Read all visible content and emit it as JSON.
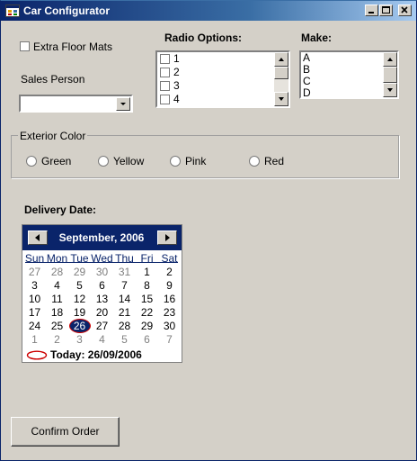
{
  "window": {
    "title": "Car Configurator",
    "controls": [
      "minimize",
      "maximize",
      "close"
    ]
  },
  "options": {
    "extra_floor_mats_label": "Extra Floor Mats",
    "extra_floor_mats_checked": false,
    "sales_person_label": "Sales Person",
    "sales_person_value": ""
  },
  "radio_options": {
    "label": "Radio Options:",
    "items": [
      {
        "label": "1",
        "checked": false
      },
      {
        "label": "2",
        "checked": false
      },
      {
        "label": "3",
        "checked": false
      },
      {
        "label": "4",
        "checked": false
      }
    ]
  },
  "make": {
    "label": "Make:",
    "items": [
      "A",
      "B",
      "C",
      "D"
    ]
  },
  "exterior_color": {
    "label": "Exterior Color",
    "options": [
      {
        "label": "Green",
        "selected": false
      },
      {
        "label": "Yellow",
        "selected": false
      },
      {
        "label": "Pink",
        "selected": false
      },
      {
        "label": "Red",
        "selected": false
      }
    ]
  },
  "delivery": {
    "label": "Delivery Date:",
    "calendar": {
      "month_title": "September, 2006",
      "weekdays": [
        "Sun",
        "Mon",
        "Tue",
        "Wed",
        "Thu",
        "Fri",
        "Sat"
      ],
      "weeks": [
        [
          "27",
          "28",
          "29",
          "30",
          "31",
          "1",
          "2"
        ],
        [
          "3",
          "4",
          "5",
          "6",
          "7",
          "8",
          "9"
        ],
        [
          "10",
          "11",
          "12",
          "13",
          "14",
          "15",
          "16"
        ],
        [
          "17",
          "18",
          "19",
          "20",
          "21",
          "22",
          "23"
        ],
        [
          "24",
          "25",
          "26",
          "27",
          "28",
          "29",
          "30"
        ],
        [
          "1",
          "2",
          "3",
          "4",
          "5",
          "6",
          "7"
        ]
      ],
      "selected_day": "26",
      "today_text": "Today: 26/09/2006"
    }
  },
  "actions": {
    "confirm_label": "Confirm Order"
  },
  "colors": {
    "titlebar": "#0a246a",
    "face": "#d4d0c8",
    "calendar_header": "#0a246a",
    "today_circle": "#cc0000"
  }
}
